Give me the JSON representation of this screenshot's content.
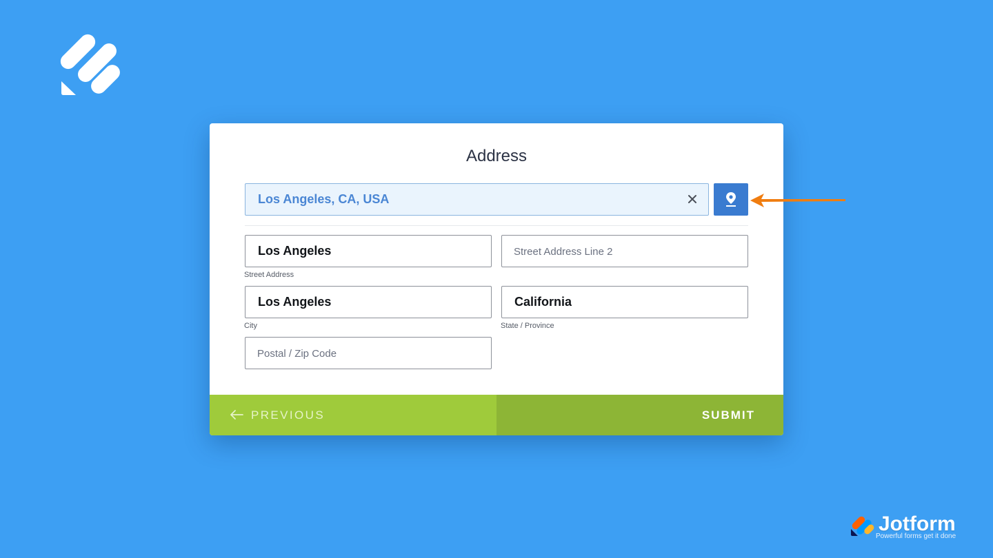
{
  "form": {
    "title": "Address",
    "address_search": {
      "value": "Los Angeles, CA, USA"
    },
    "fields": {
      "street_address": {
        "value": "Los Angeles",
        "sublabel": "Street Address"
      },
      "street_address_line2": {
        "placeholder": "Street Address Line 2"
      },
      "city": {
        "value": "Los Angeles",
        "sublabel": "City"
      },
      "state": {
        "value": "California",
        "sublabel": "State / Province"
      },
      "postal": {
        "placeholder": "Postal / Zip Code"
      }
    },
    "buttons": {
      "previous": "PREVIOUS",
      "submit": "SUBMIT"
    }
  },
  "brand": {
    "name": "Jotform",
    "tagline": "Powerful forms get it done"
  },
  "colors": {
    "background": "#3d9ff3",
    "accent_blue": "#3a7bd0",
    "previous_green": "#9fcb3b",
    "submit_green": "#8db536",
    "annotation_arrow": "#f07d10"
  },
  "icons": {
    "logo": "jotform-stripes-logo",
    "clear": "close-icon",
    "geolocate": "map-pin-icon",
    "previous": "arrow-left-icon",
    "annotation": "orange-pointer-arrow"
  }
}
